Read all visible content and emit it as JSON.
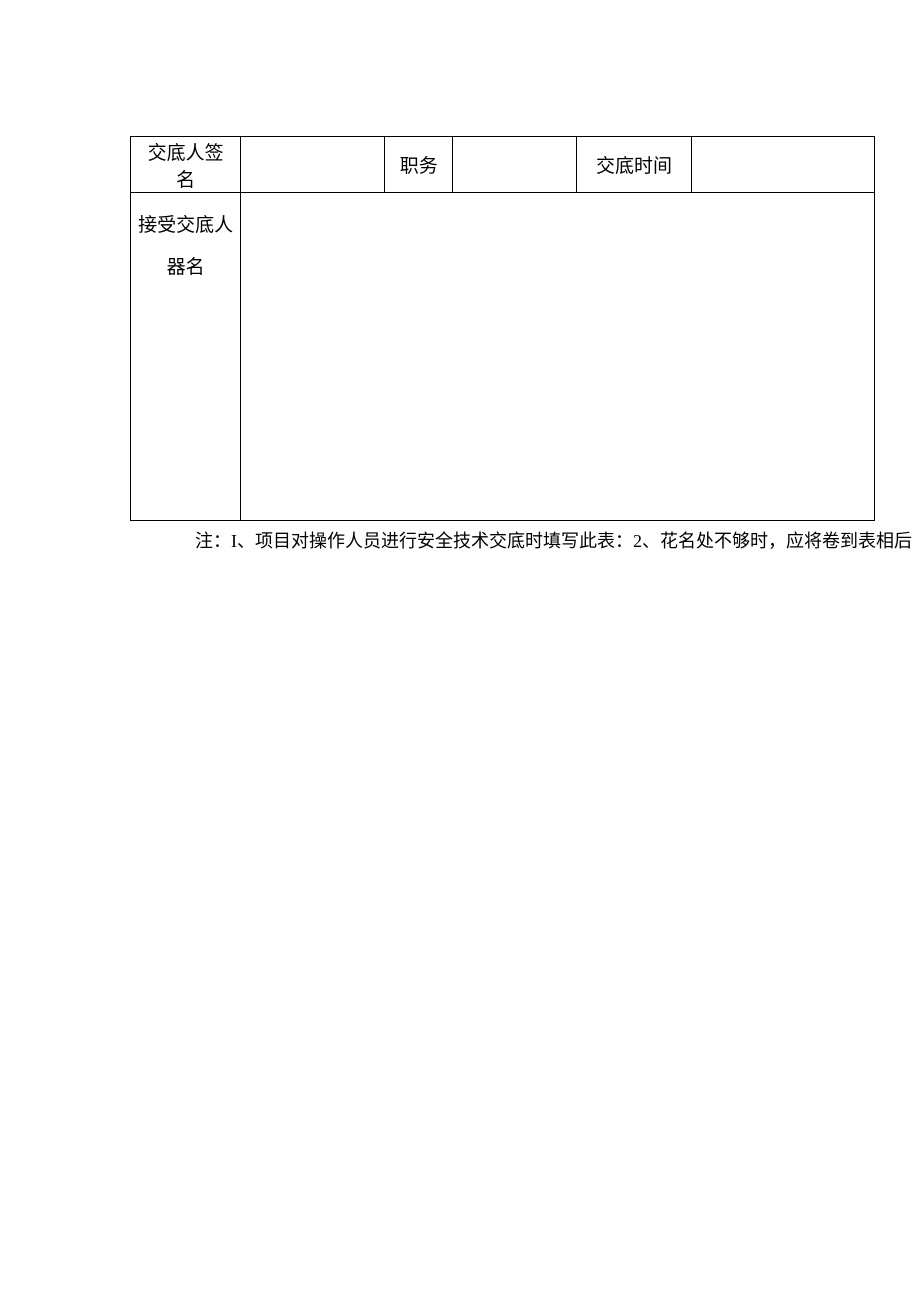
{
  "table": {
    "row1": {
      "signer_label": "交底人签名",
      "signer_value": "",
      "position_label": "职务",
      "position_value": "",
      "time_label": "交底时间",
      "time_value": ""
    },
    "row2": {
      "vertical_label": "接受交底人器名",
      "content": ""
    }
  },
  "note": "注：I、项目对操作人员进行安全技术交底时填写此表：2、花名处不够时，应将卷到表相后"
}
